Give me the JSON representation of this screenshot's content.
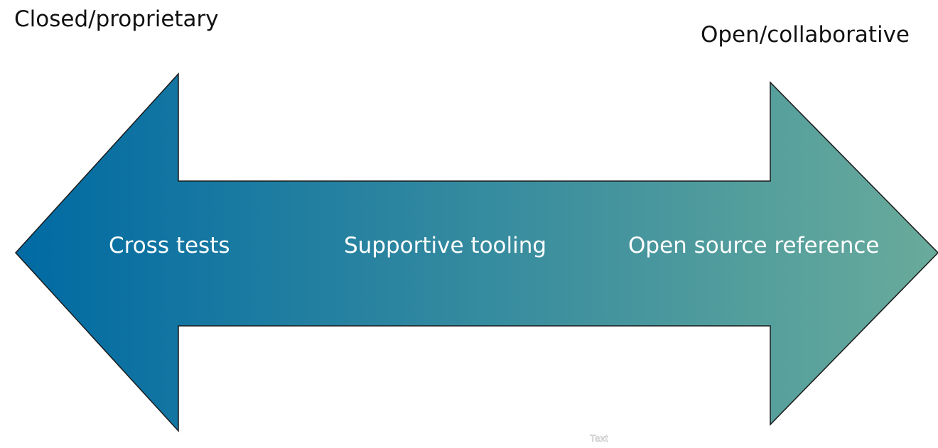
{
  "spectrum": {
    "left_label": "Closed/proprietary",
    "right_label": "Open/collaborative",
    "stages": [
      {
        "label": "Cross tests"
      },
      {
        "label": "Supportive tooling"
      },
      {
        "label": "Open source reference"
      }
    ],
    "placeholder": "Text"
  },
  "colors": {
    "gradient_start": "#006aa3",
    "gradient_end": "#69ab9b",
    "outline": "#1a1a1a",
    "stage_text": "#ffffff"
  }
}
